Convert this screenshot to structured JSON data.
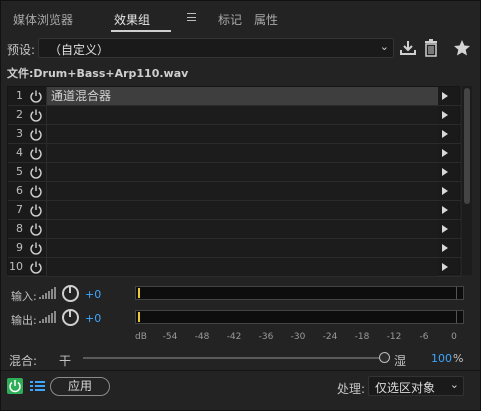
{
  "tabs": [
    {
      "label": "媒体浏览器",
      "active": false
    },
    {
      "label": "效果组",
      "active": true
    },
    {
      "label": "标记",
      "active": false
    },
    {
      "label": "属性",
      "active": false
    }
  ],
  "preset": {
    "label": "预设:",
    "value": "（自定义）"
  },
  "file": {
    "label": "文件:Drum+Bass+Arp110.wav"
  },
  "rack": {
    "rows": [
      {
        "num": "1",
        "effect": "通道混合器"
      },
      {
        "num": "2",
        "effect": ""
      },
      {
        "num": "3",
        "effect": ""
      },
      {
        "num": "4",
        "effect": ""
      },
      {
        "num": "5",
        "effect": ""
      },
      {
        "num": "6",
        "effect": ""
      },
      {
        "num": "7",
        "effect": ""
      },
      {
        "num": "8",
        "effect": ""
      },
      {
        "num": "9",
        "effect": ""
      },
      {
        "num": "10",
        "effect": ""
      }
    ]
  },
  "input": {
    "label": "输入:",
    "gain": "+0"
  },
  "output": {
    "label": "输出:",
    "gain": "+0"
  },
  "scale": {
    "ticks": [
      "dB",
      "-54",
      "-48",
      "-42",
      "-36",
      "-30",
      "-24",
      "-18",
      "-12",
      "-6",
      "0"
    ]
  },
  "mix": {
    "label": "混合:",
    "dry": "干",
    "wet": "湿",
    "value": "100",
    "unit": "%",
    "level": 1.0
  },
  "bottom": {
    "apply_label": "应用",
    "process_label": "处理:",
    "process_value": "仅选区对象"
  },
  "colors": {
    "accent": "#3ea6ff",
    "power_on": "#2fae59",
    "meter_peak": "#e8c93b"
  }
}
